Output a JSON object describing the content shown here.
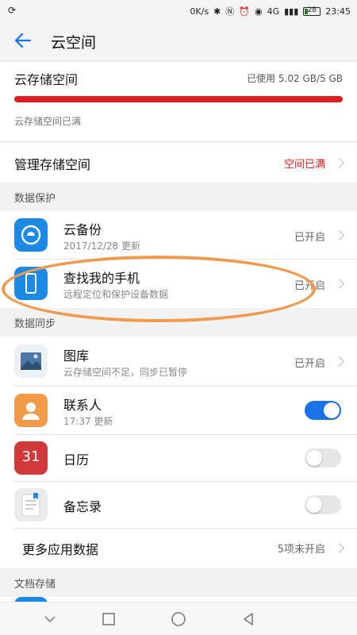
{
  "status_bar": {
    "left_icon": "sync-icon",
    "speed": "0K/s",
    "signal": "4G",
    "battery": "28",
    "time": "23:45"
  },
  "header": {
    "title": "云空间"
  },
  "storage": {
    "title": "云存储空间",
    "used": "已使用 5.02 GB/5 GB",
    "usage_ratio": 1.0,
    "bar_color": "#e02020",
    "note": "云存储空间已满"
  },
  "manage": {
    "label": "管理存储空间",
    "status": "空间已满",
    "status_color": "#e02020"
  },
  "sections": {
    "data_protection": "数据保护",
    "data_sync": "数据同步",
    "doc_storage": "文档存储"
  },
  "protection_items": [
    {
      "title": "云备份",
      "subtitle": "2017/12/28 更新",
      "status": "已开启",
      "icon": "cloud-backup-icon"
    },
    {
      "title": "查找我的手机",
      "subtitle": "远程定位和保护设备数据",
      "status": "已开启",
      "icon": "find-phone-icon"
    }
  ],
  "sync_items": [
    {
      "title": "图库",
      "subtitle": "云存储空间不足，同步已暂停",
      "status": "已开启",
      "icon": "gallery-icon"
    },
    {
      "title": "联系人",
      "subtitle": "17:37 更新",
      "toggle": true,
      "icon": "contacts-icon"
    },
    {
      "title": "日历",
      "toggle": false,
      "icon": "calendar-icon",
      "calendar_day": "31"
    },
    {
      "title": "备忘录",
      "toggle": false,
      "icon": "notes-icon"
    }
  ],
  "more": {
    "label": "更多应用数据",
    "status": "5项未开启"
  },
  "colors": {
    "accent": "#1a73e8",
    "highlight": "#f09a4e"
  },
  "nav": [
    "back-nav-icon",
    "home-nav-icon",
    "recents-nav-icon",
    "collapse-nav-icon"
  ]
}
